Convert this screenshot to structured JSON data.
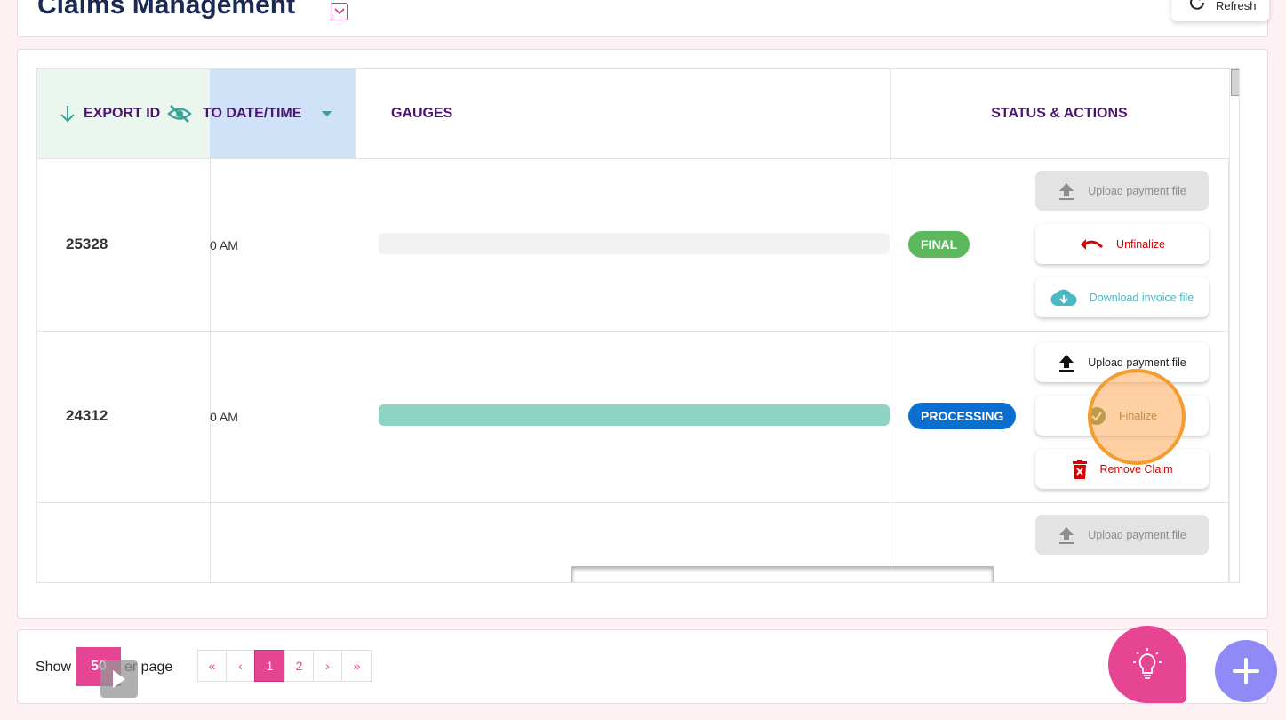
{
  "header": {
    "title": "Claims Management",
    "refresh_label": "Refresh"
  },
  "table": {
    "columns": {
      "export_id": "EXPORT ID",
      "date": "TO DATE/TIME",
      "gauges": "GAUGES",
      "status": "STATUS & ACTIONS"
    },
    "rows": [
      {
        "id": "25328",
        "date": "0 AM",
        "gauge_fill": 0,
        "status": "FINAL",
        "actions": [
          "Upload payment file",
          "Unfinalize",
          "Download invoice file"
        ]
      },
      {
        "id": "24312",
        "date": "0 AM",
        "gauge_fill": 1,
        "status": "PROCESSING",
        "actions": [
          "Upload payment file",
          "Finalize",
          "Remove Claim"
        ]
      },
      {
        "id": "",
        "date": "",
        "actions": [
          "Upload payment file"
        ]
      }
    ]
  },
  "footer": {
    "show_label": "Show",
    "per_page_value": "50",
    "per_page_label": "er page",
    "pager": [
      "«",
      "‹",
      "1",
      "2",
      "›",
      "»"
    ],
    "current_page": "1"
  },
  "colors": {
    "accent": "#e54592",
    "final": "#5cb85c",
    "processing": "#0b6fcf",
    "gauge": "#8fd3c5",
    "header_text": "#4a1470"
  }
}
